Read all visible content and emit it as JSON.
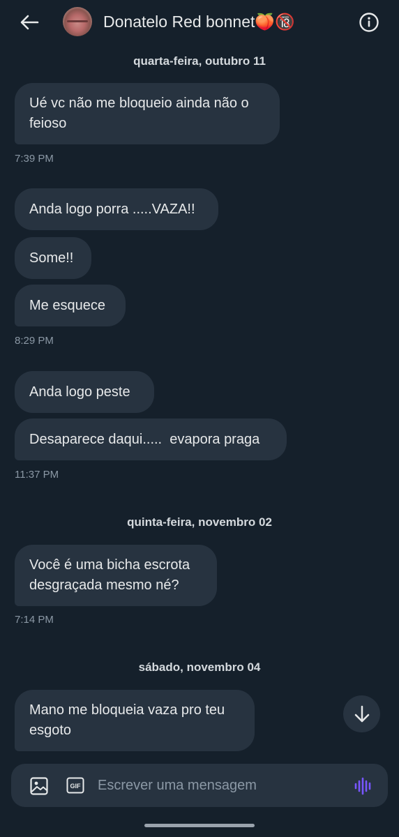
{
  "header": {
    "back_icon": "arrow-left-icon",
    "chat_name": "Donatelo Red bonnet🍑🔞",
    "info_icon": "info-icon"
  },
  "conversation": {
    "date_1": "quarta-feira, outubro 11",
    "msg_1": "Ué vc não me bloqueio ainda não o feioso",
    "time_1": "7:39 PM",
    "msg_2": "Anda logo porra .....VAZA!!",
    "msg_3": "Some!!",
    "msg_4": "Me esquece",
    "time_2": "8:29 PM",
    "msg_5": "Anda logo peste",
    "msg_6": "Desaparece daqui.....  evapora praga",
    "time_3": "11:37 PM",
    "date_2": "quinta-feira, novembro 02",
    "msg_7": "Você é uma bicha escrota desgraçada mesmo né?",
    "time_4": "7:14 PM",
    "date_3": "sábado, novembro 04",
    "msg_8": "Mano me bloqueia vaza pro teu esgoto"
  },
  "scroll_down_icon": "arrow-down-icon",
  "composer": {
    "image_icon": "image-icon",
    "gif_icon": "gif-icon",
    "gif_label": "GIF",
    "placeholder": "Escrever uma mensagem",
    "voice_icon": "voice-wave-icon"
  },
  "colors": {
    "background": "#15202b",
    "bubble": "#273340",
    "accent_voice": "#7856ff",
    "muted_text": "#8b98a5"
  }
}
